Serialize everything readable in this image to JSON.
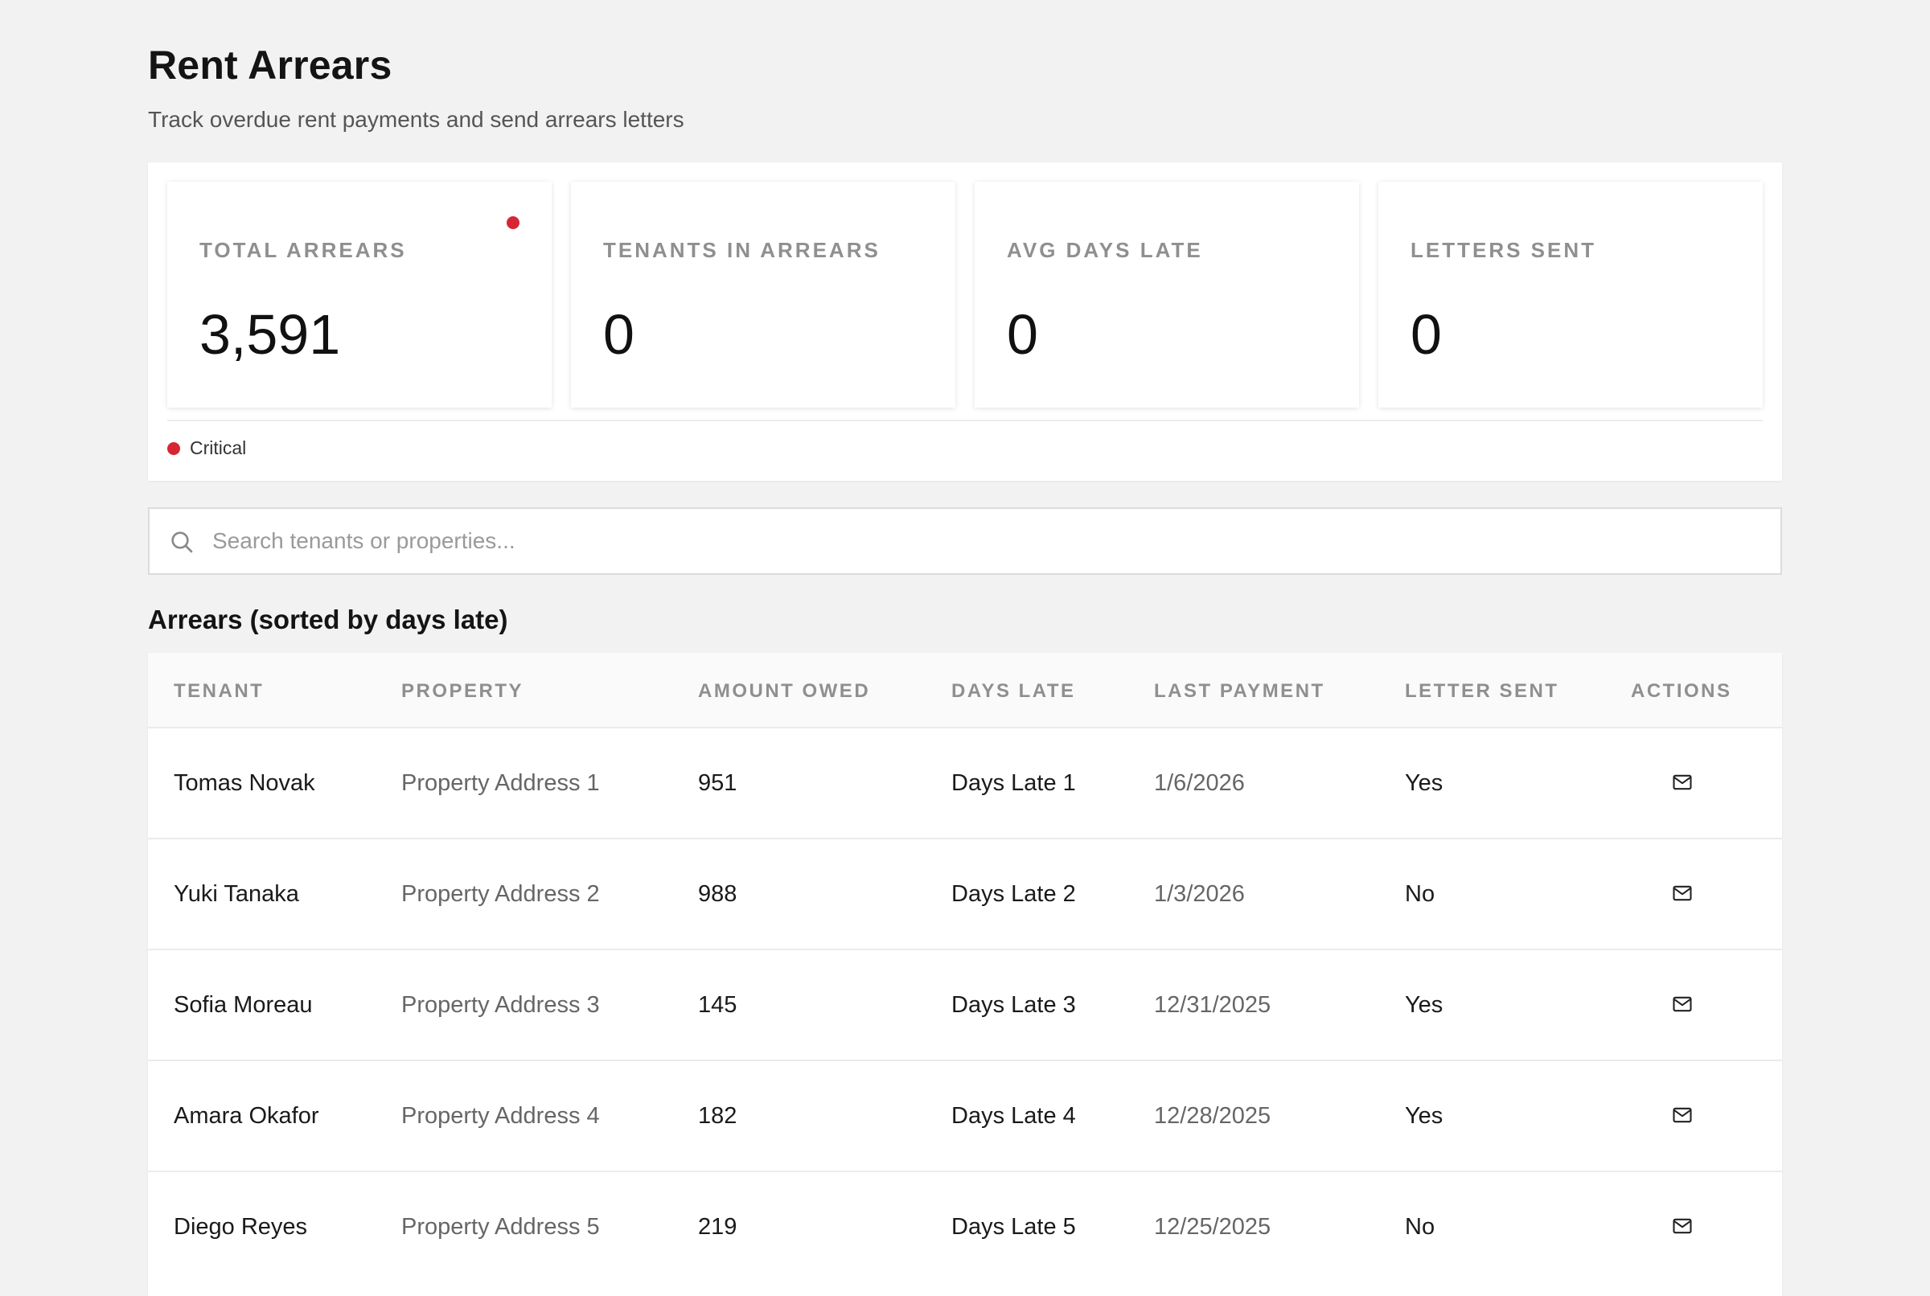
{
  "header": {
    "title": "Rent Arrears",
    "subtitle": "Track overdue rent payments and send arrears letters"
  },
  "kpis": [
    {
      "label": "TOTAL ARREARS",
      "value": "3,591",
      "critical": true
    },
    {
      "label": "TENANTS IN ARREARS",
      "value": "0",
      "critical": false
    },
    {
      "label": "AVG DAYS LATE",
      "value": "0",
      "critical": false
    },
    {
      "label": "LETTERS SENT",
      "value": "0",
      "critical": false
    }
  ],
  "legend": {
    "critical_label": "Critical",
    "critical_color": "#d72633"
  },
  "search": {
    "placeholder": "Search tenants or properties..."
  },
  "table": {
    "title": "Arrears (sorted by days late)",
    "columns": [
      "TENANT",
      "PROPERTY",
      "AMOUNT OWED",
      "DAYS LATE",
      "LAST PAYMENT",
      "LETTER SENT",
      "ACTIONS"
    ],
    "rows": [
      {
        "tenant": "Tomas Novak",
        "property": "Property Address 1",
        "amount": "951",
        "days_late": "Days Late 1",
        "last_payment": "1/6/2026",
        "letter_sent": "Yes",
        "action_icon": "mail-icon"
      },
      {
        "tenant": "Yuki Tanaka",
        "property": "Property Address 2",
        "amount": "988",
        "days_late": "Days Late 2",
        "last_payment": "1/3/2026",
        "letter_sent": "No",
        "action_icon": "mail-icon"
      },
      {
        "tenant": "Sofia Moreau",
        "property": "Property Address 3",
        "amount": "145",
        "days_late": "Days Late 3",
        "last_payment": "12/31/2025",
        "letter_sent": "Yes",
        "action_icon": "mail-icon"
      },
      {
        "tenant": "Amara Okafor",
        "property": "Property Address 4",
        "amount": "182",
        "days_late": "Days Late 4",
        "last_payment": "12/28/2025",
        "letter_sent": "Yes",
        "action_icon": "mail-icon"
      },
      {
        "tenant": "Diego Reyes",
        "property": "Property Address 5",
        "amount": "219",
        "days_late": "Days Late 5",
        "last_payment": "12/25/2025",
        "letter_sent": "No",
        "action_icon": "mail-icon"
      }
    ]
  }
}
